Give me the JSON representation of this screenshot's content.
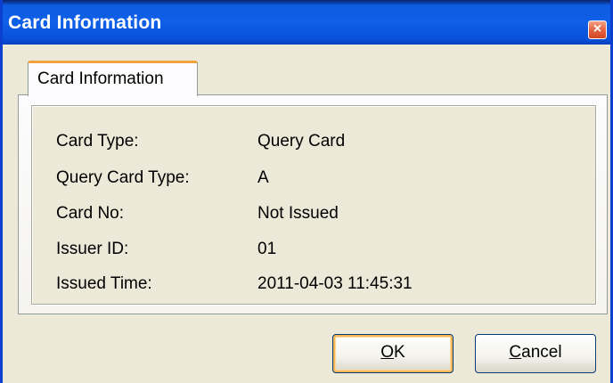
{
  "window": {
    "title": "Card Information",
    "close_icon": "×"
  },
  "tab": {
    "label": "Card Information"
  },
  "fields": [
    {
      "label": "Card Type:",
      "value": "Query Card"
    },
    {
      "label": "Query Card Type:",
      "value": "A"
    },
    {
      "label": "Card No:",
      "value": "Not Issued"
    },
    {
      "label": "Issuer ID:",
      "value": "01"
    },
    {
      "label": "Issued Time:",
      "value": "2011-04-03 11:45:31"
    }
  ],
  "buttons": {
    "ok_mnemonic": "O",
    "ok_rest": "K",
    "cancel_mnemonic": "C",
    "cancel_rest": "ancel"
  }
}
